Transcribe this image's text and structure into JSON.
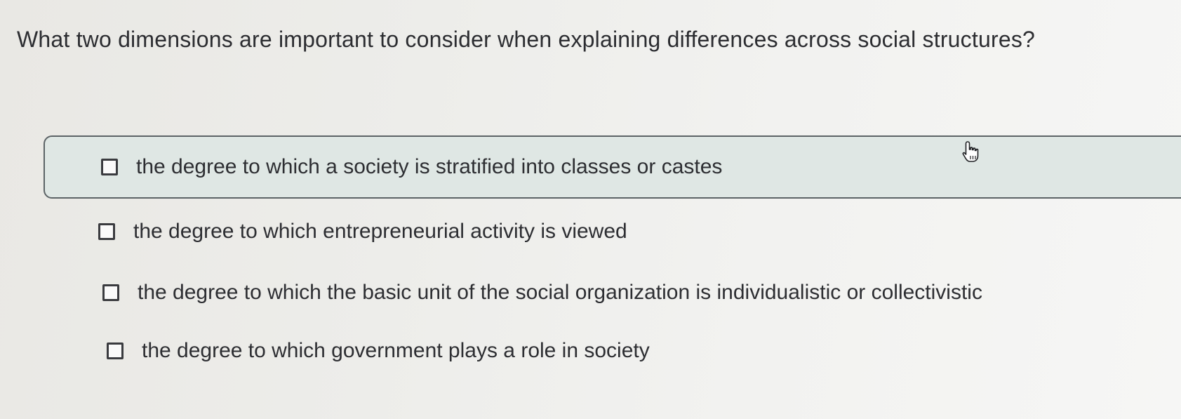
{
  "question": {
    "text": "What two dimensions are important to consider when explaining differences across social structures?"
  },
  "options": [
    {
      "label": "the degree to which a society is stratified into classes or castes",
      "checked": false,
      "highlighted": true
    },
    {
      "label": "the degree to which entrepreneurial activity is viewed",
      "checked": false,
      "highlighted": false
    },
    {
      "label": "the degree to which the basic unit of the social organization is individualistic or collectivistic",
      "checked": false,
      "highlighted": false
    },
    {
      "label": "the degree to which government plays a role in society",
      "checked": false,
      "highlighted": false
    }
  ],
  "cursor": {
    "icon": "hand-pointer-icon"
  }
}
